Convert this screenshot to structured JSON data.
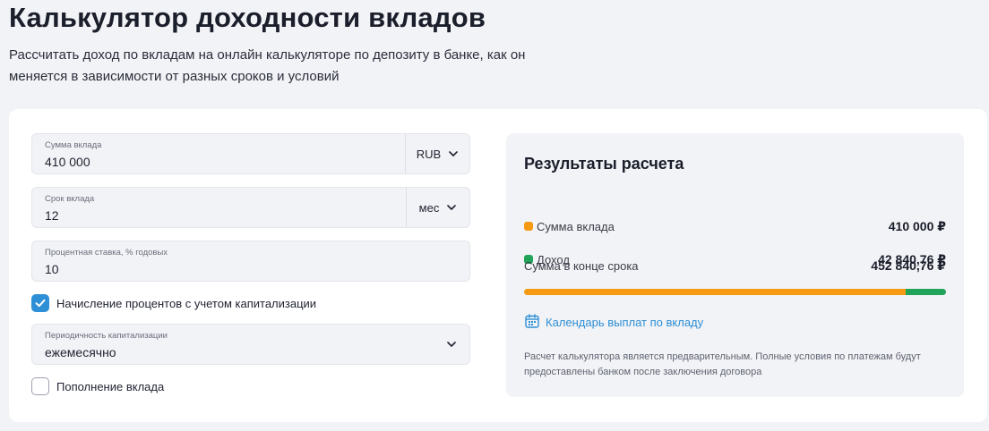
{
  "header": {
    "title": "Калькулятор доходности вкладов",
    "subtitle": "Рассчитать доход по вкладам на онлайн калькуляторе по депозиту в банке, как он меняется в зависимости от разных сроков и условий"
  },
  "form": {
    "amount": {
      "label": "Сумма вклада",
      "value": "410 000",
      "currency": "RUB"
    },
    "term": {
      "label": "Срок вклада",
      "value": "12",
      "unit": "мес"
    },
    "rate": {
      "label": "Процентная ставка, % годовых",
      "value": "10"
    },
    "capitalization": {
      "label": "Начисление процентов с учетом капитализации",
      "checked": true
    },
    "periodicity": {
      "label": "Периодичность капитализации",
      "value": "ежемесячно"
    },
    "replenishment": {
      "label": "Пополнение вклада",
      "checked": false
    }
  },
  "results": {
    "title": "Результаты расчета",
    "deposit": {
      "label": "Сумма вклада",
      "value": "410 000 ₽",
      "color": "#f59a12"
    },
    "income": {
      "label": "Доход",
      "value": "42 840,76 ₽",
      "color": "#21a35a"
    },
    "total": {
      "label": "Сумма в конце срока",
      "value": "452 840,76 ₽"
    },
    "bar": {
      "deposit_share": 0.9054,
      "income_share": 0.0946
    },
    "calendar_link": "Календарь выплат по вкладу",
    "note": "Расчет калькулятора является предварительным. Полные условия по платежам будут предоставлены банком после заключения договора"
  },
  "colors": {
    "accent": "#2d8fd6",
    "deposit": "#f59a12",
    "income": "#21a35a"
  }
}
